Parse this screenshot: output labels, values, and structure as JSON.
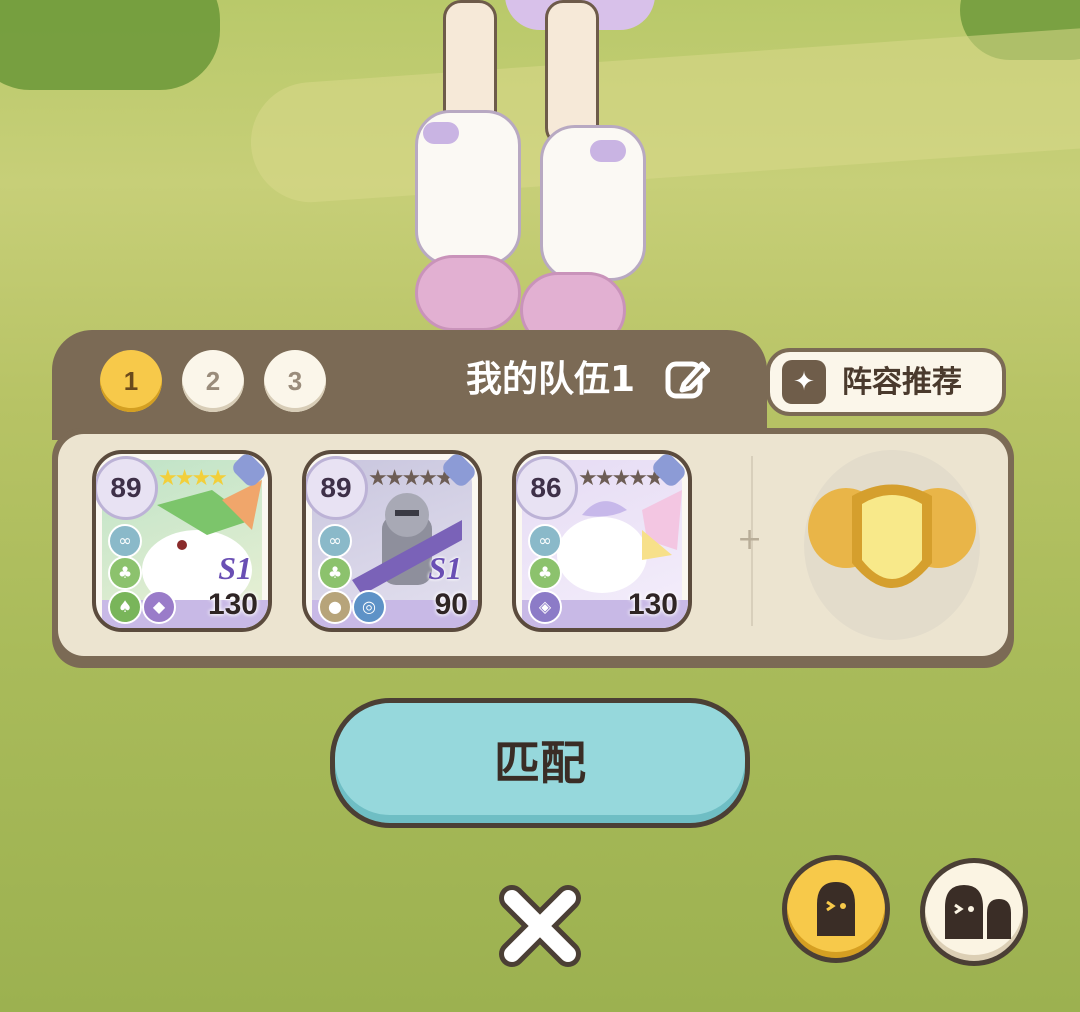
{
  "team_tabs": [
    {
      "label": "1",
      "active": true
    },
    {
      "label": "2",
      "active": false
    },
    {
      "label": "3",
      "active": false
    }
  ],
  "team_name": "我的队伍1",
  "recommend_label": "阵容推荐",
  "cards": [
    {
      "level": "89",
      "stars": "★★★★",
      "season": "S1",
      "power": "130",
      "art_colors": [
        "#bfe3c7",
        "#e9f0d4"
      ]
    },
    {
      "level": "89",
      "stars": "★★★★★",
      "season": "S1",
      "power": "90",
      "art_colors": [
        "#c9c6de",
        "#e3e0ef"
      ]
    },
    {
      "level": "86",
      "stars": "★★★★★",
      "season": "",
      "power": "130",
      "art_colors": [
        "#e6dcf4",
        "#f4eefb"
      ]
    }
  ],
  "match_label": "匹配",
  "colors": {
    "accent_yellow": "#f7c94a",
    "match_teal": "#96d8dc",
    "panel_brown": "#7b6a55"
  }
}
